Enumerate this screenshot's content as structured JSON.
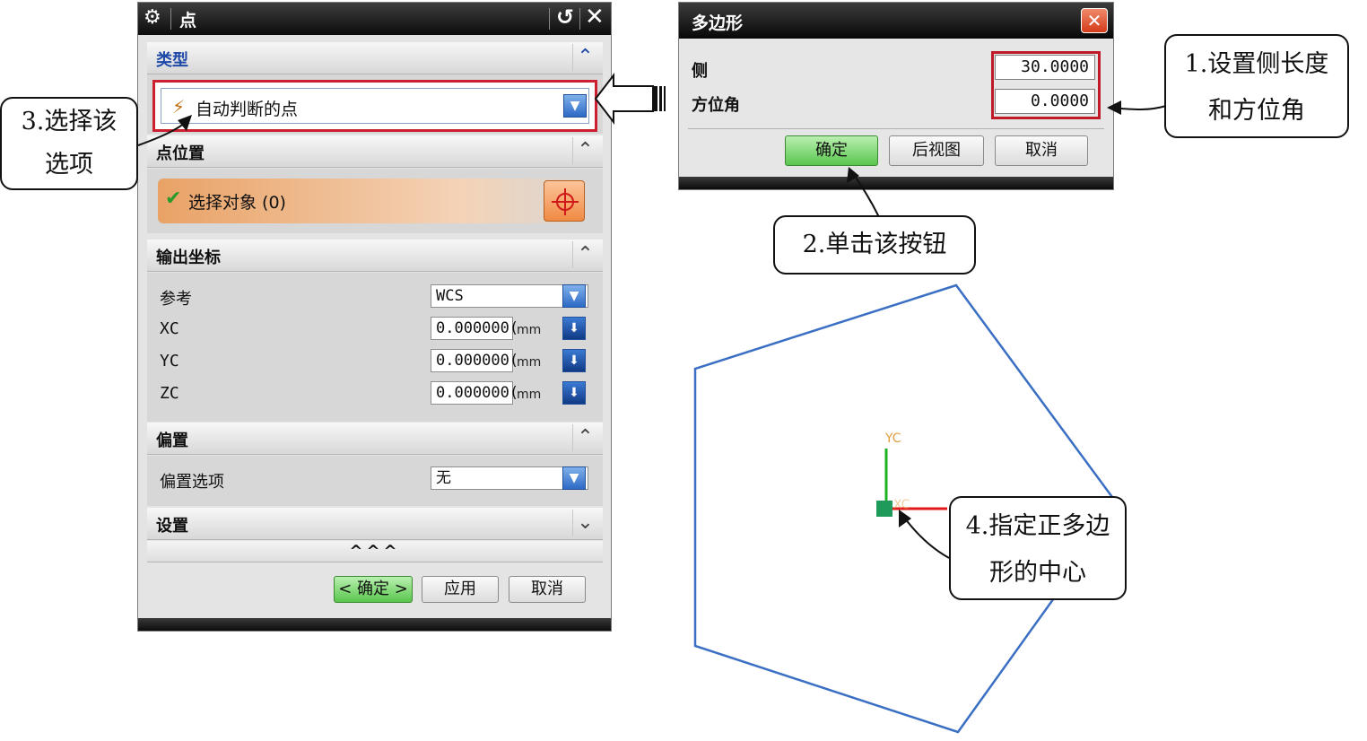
{
  "point_dialog": {
    "title": "点",
    "sections": {
      "type": {
        "label": "类型",
        "selected": "自动判断的点"
      },
      "point_location": {
        "label": "点位置",
        "select_object": "选择对象 (0)"
      },
      "output_coords": {
        "label": "输出坐标",
        "reference": {
          "label": "参考",
          "value": "WCS"
        },
        "xc": {
          "label": "XC",
          "value": "0.000000(",
          "unit": "mm"
        },
        "yc": {
          "label": "YC",
          "value": "0.000000(",
          "unit": "mm"
        },
        "zc": {
          "label": "ZC",
          "value": "0.000000(",
          "unit": "mm"
        }
      },
      "offset": {
        "label": "偏置",
        "option_label": "偏置选项",
        "option_value": "无"
      },
      "settings": {
        "label": "设置"
      }
    },
    "expand_glyph": "^^^",
    "buttons": {
      "ok": "< 确定 >",
      "apply": "应用",
      "cancel": "取消"
    }
  },
  "polygon_dialog": {
    "title": "多边形",
    "side": {
      "label": "侧",
      "value": "30.0000"
    },
    "orientation": {
      "label": "方位角",
      "value": "0.0000"
    },
    "buttons": {
      "ok": "确定",
      "back": "后视图",
      "cancel": "取消"
    }
  },
  "callouts": {
    "step1_line1": "1.设置侧长度",
    "step1_line2": "和方位角",
    "step2": "2.单击该按钮",
    "step3_line1": "3.选择该",
    "step3_line2": "选项",
    "step4_line1": "4.指定正多边",
    "step4_line2": "形的中心"
  },
  "viewport": {
    "axis_y_label": "YC",
    "axis_x_label": "XC",
    "polygon_color": "#3a6fc4"
  },
  "colors": {
    "highlight_red": "#c01a28",
    "ok_green": "#5ac54e",
    "select_orange": "#e9a266"
  }
}
